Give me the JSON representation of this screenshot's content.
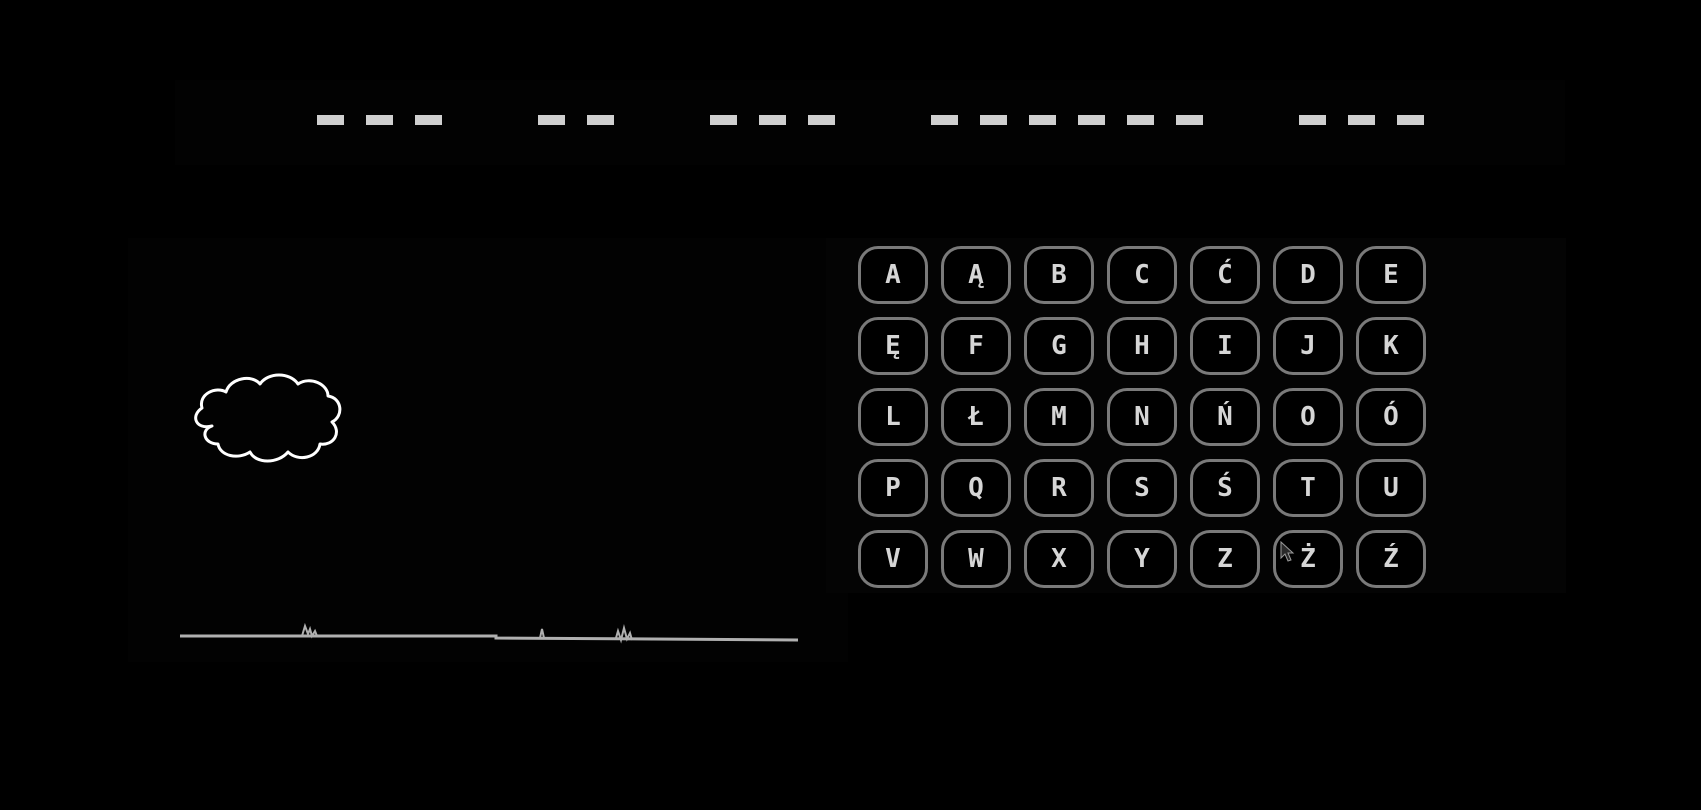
{
  "word": {
    "groups": [
      3,
      2,
      3,
      6,
      3
    ],
    "color": "#cfcfcf"
  },
  "keyboard": {
    "border_color": "#7a7a7a",
    "text_color": "#d6d6d6",
    "rows": [
      [
        "A",
        "Ą",
        "B",
        "C",
        "Ć",
        "D",
        "E"
      ],
      [
        "Ę",
        "F",
        "G",
        "H",
        "I",
        "J",
        "K"
      ],
      [
        "L",
        "Ł",
        "M",
        "N",
        "Ń",
        "O",
        "Ó"
      ],
      [
        "P",
        "Q",
        "R",
        "S",
        "Ś",
        "T",
        "U"
      ],
      [
        "V",
        "W",
        "X",
        "Y",
        "Z",
        "Ż",
        "Ź"
      ]
    ]
  },
  "scene": {
    "icons": [
      "cloud-icon",
      "ground-line",
      "grass-tuft-icon"
    ]
  }
}
